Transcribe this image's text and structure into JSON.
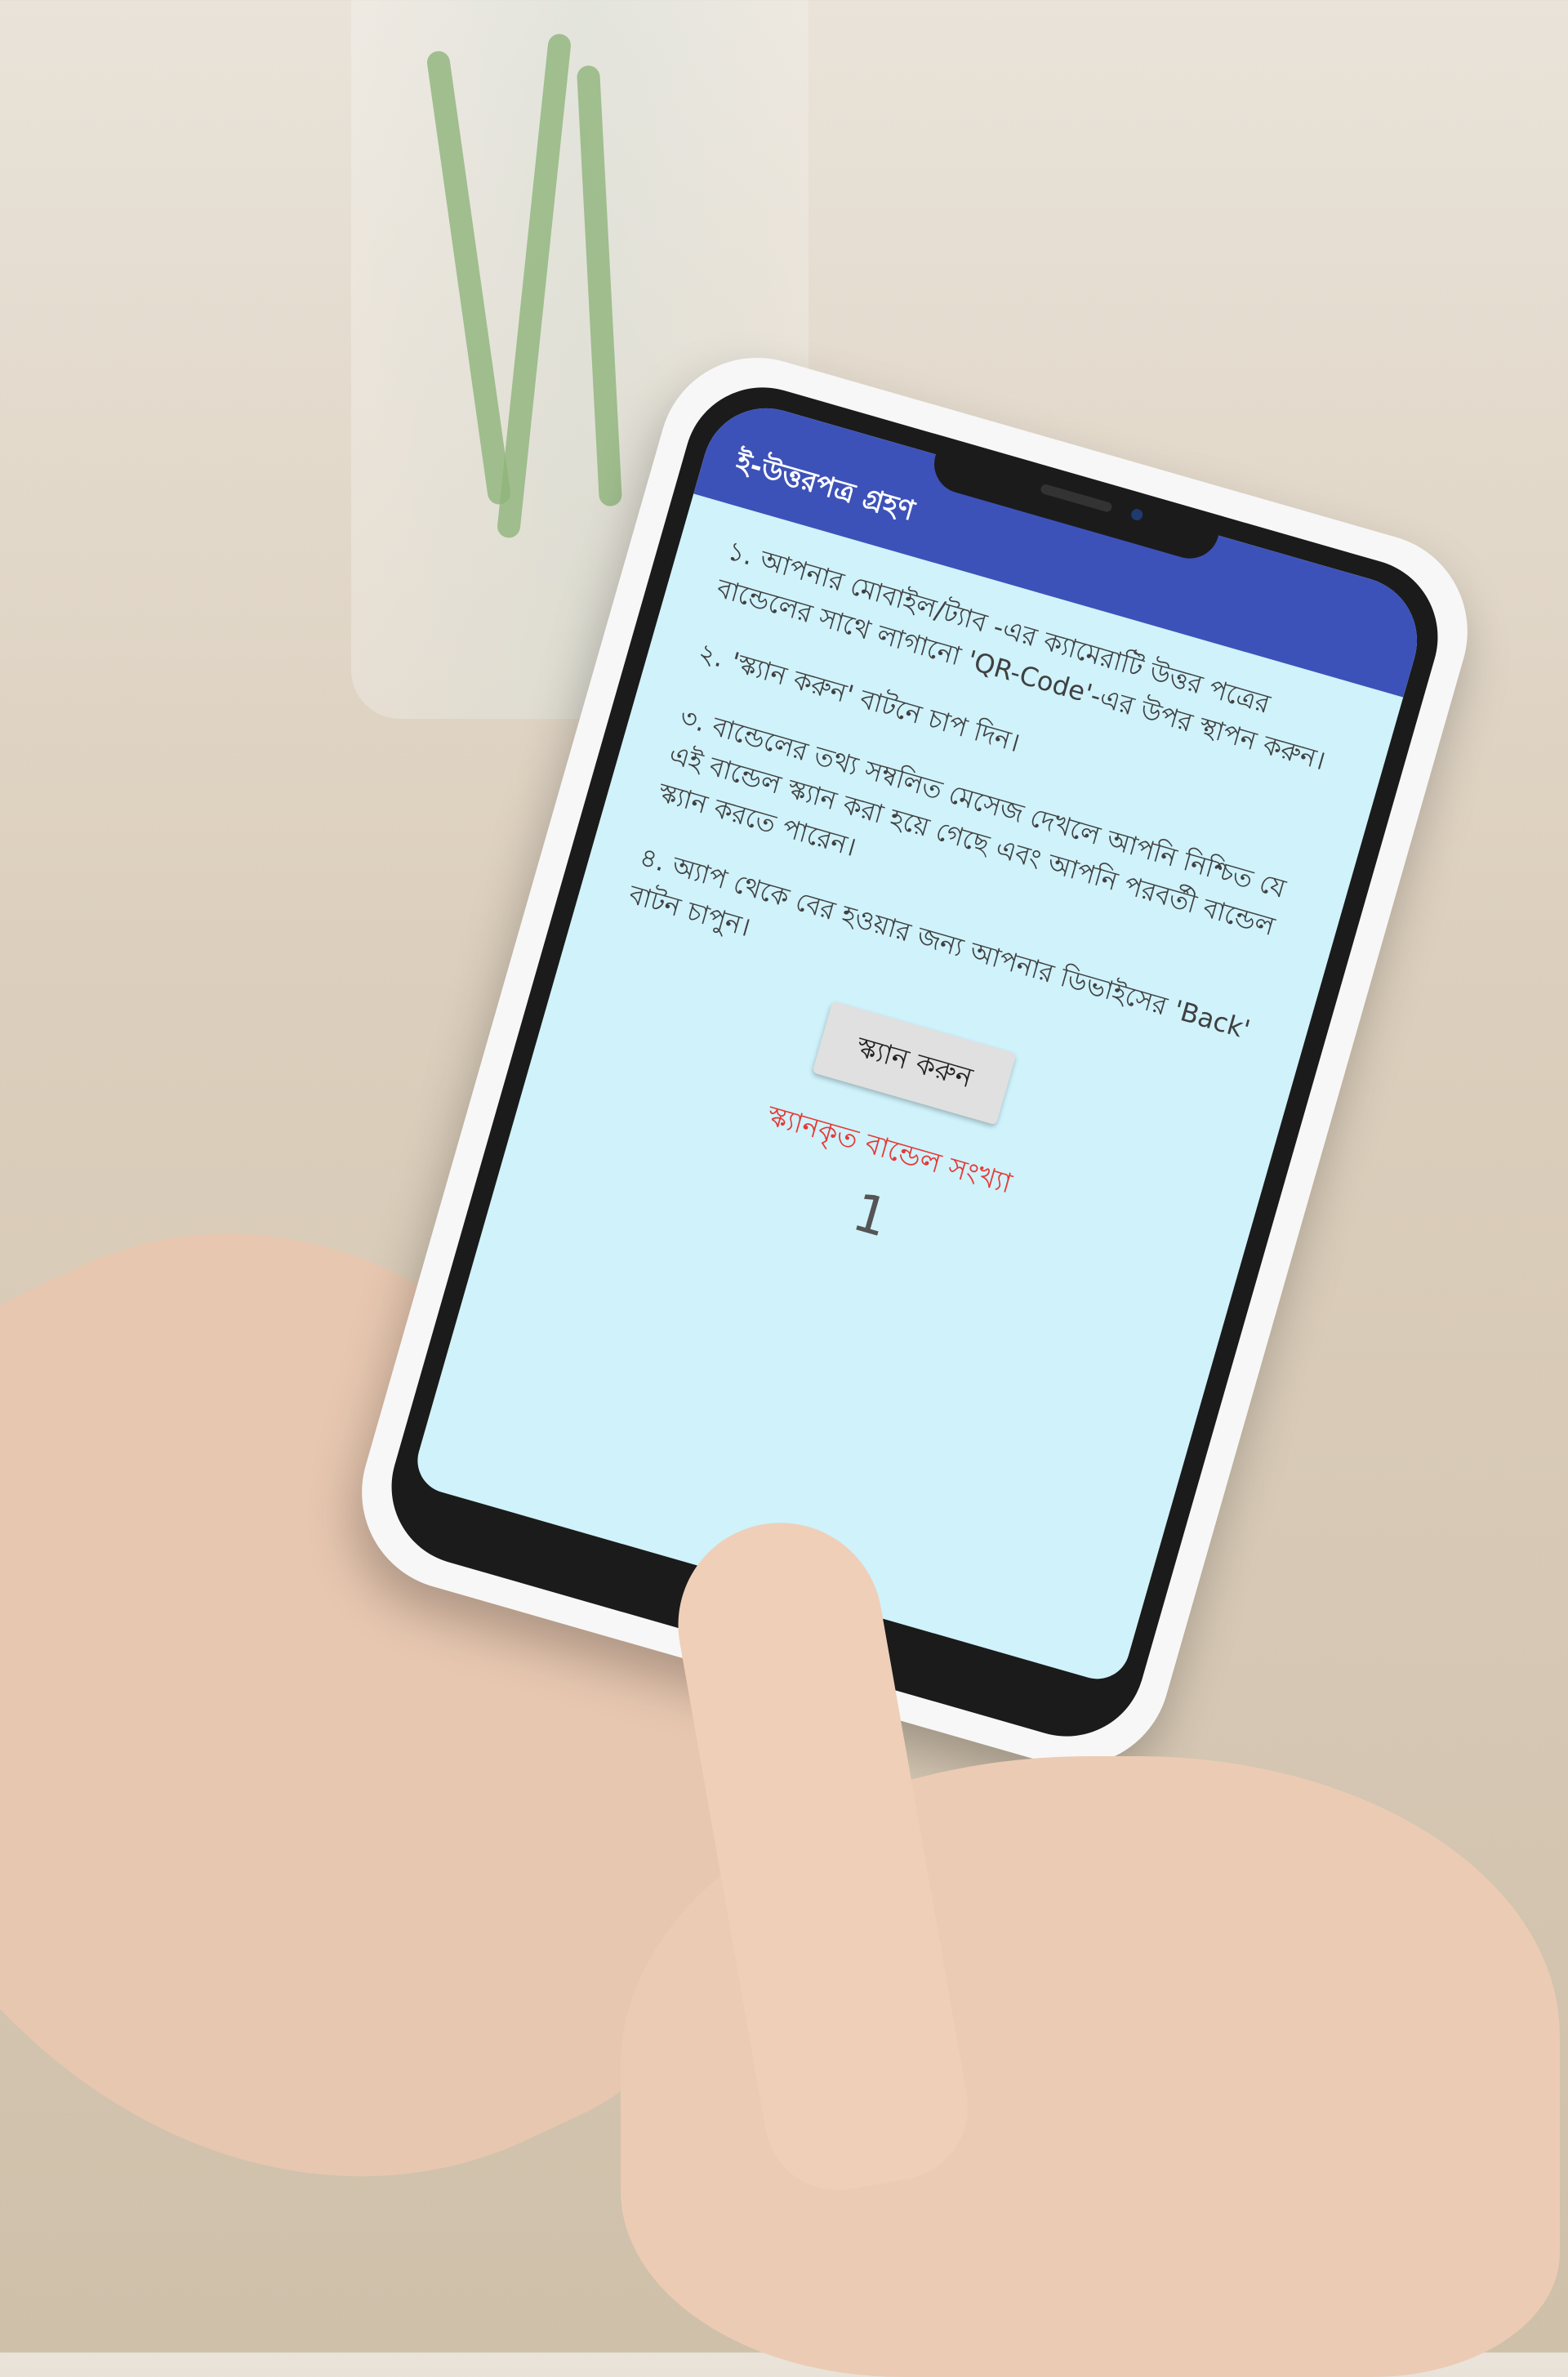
{
  "app": {
    "title": "ই-উত্তরপত্র গ্রহণ"
  },
  "instructions": [
    "১. আপনার মোবাইল/ট্যাব -এর ক্যামেরাটি উত্তর পত্রের বান্ডেলের সাথে লাগানো 'QR-Code'-এর উপর স্থাপন করুন।",
    "২. 'স্ক্যান করুন' বাটনে চাপ দিন।",
    "৩. বান্ডেলের তথ্য সম্বলিত মেসেজ দেখলে আপনি নিশ্চিত যে এই বান্ডেল স্ক্যান করা হয়ে গেছে এবং আপনি পরবর্তী বান্ডেল স্ক্যান করতে পারেন।",
    "৪. অ্যাপ থেকে বের হওয়ার জন্য আপনার ডিভাইসের 'Back' বাটন চাপুন।"
  ],
  "scan_button_label": "স্ক্যান করুন",
  "scanned": {
    "label": "স্ক্যানকৃত বান্ডেল সংখ্যা",
    "count": "1"
  },
  "colors": {
    "appbar": "#3d52b8",
    "screen_bg": "#cff2fb",
    "count_label": "#e53935"
  }
}
